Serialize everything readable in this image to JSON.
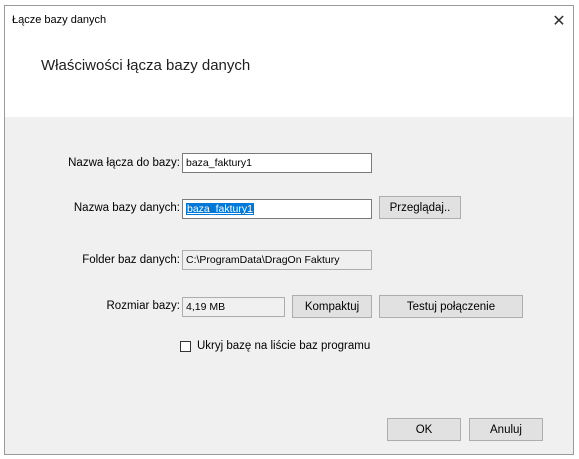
{
  "window": {
    "title": "Łącze bazy danych",
    "close_glyph": "✕"
  },
  "header": {
    "heading": "Właściwości łącza bazy danych"
  },
  "form": {
    "link_name_label": "Nazwa łącza do bazy:",
    "link_name_value": "baza_faktury1",
    "db_name_label": "Nazwa bazy danych:",
    "db_name_value": "baza_faktury1",
    "browse_label": "Przeglądaj..",
    "folder_label": "Folder baz danych:",
    "folder_value": "C:\\ProgramData\\DragOn Faktury",
    "size_label": "Rozmiar bazy:",
    "size_value": "4,19 MB",
    "compact_label": "Kompaktuj",
    "test_label": "Testuj połączenie",
    "hide_checkbox_label": "Ukryj bazę na liście baz programu",
    "hide_checked": false
  },
  "footer": {
    "ok_label": "OK",
    "cancel_label": "Anuluj"
  }
}
